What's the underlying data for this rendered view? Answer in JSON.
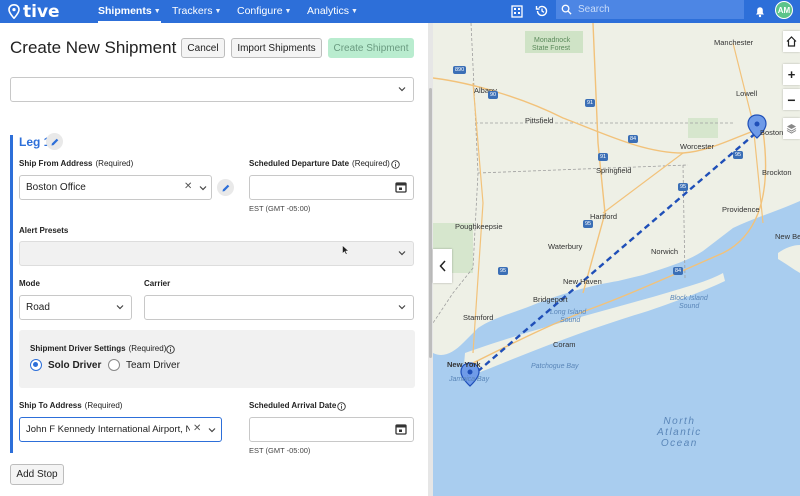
{
  "nav": {
    "brand": "tive",
    "items": [
      {
        "label": "Shipments",
        "active": true
      },
      {
        "label": "Trackers",
        "active": false
      },
      {
        "label": "Configure",
        "active": false
      },
      {
        "label": "Analytics",
        "active": false
      }
    ],
    "search_placeholder": "Search",
    "avatar_initials": "AM"
  },
  "form": {
    "title": "Create New Shipment",
    "cancel_label": "Cancel",
    "import_label": "Import Shipments",
    "create_label": "Create Shipment",
    "template_value": "",
    "leg_title": "Leg 1",
    "ship_from_label": "Ship From Address",
    "required": "(Required)",
    "ship_from_value": "Boston Office",
    "departure_label": "Scheduled Departure Date",
    "departure_value": "",
    "departure_tz": "EST (GMT -05:00)",
    "alert_presets_label": "Alert Presets",
    "mode_label": "Mode",
    "mode_value": "Road",
    "carrier_label": "Carrier",
    "carrier_value": "",
    "driver_settings_label": "Shipment Driver Settings",
    "solo_driver": "Solo Driver",
    "team_driver": "Team Driver",
    "ship_to_label": "Ship To Address",
    "ship_to_value": "John F Kennedy International Airport, Ne",
    "arrival_label": "Scheduled Arrival Date",
    "arrival_value": "",
    "arrival_tz": "EST (GMT -05:00)",
    "add_stop": "Add Stop"
  },
  "map": {
    "route_color": "#1f4fb8",
    "labels": {
      "monadnock": "Monadnock",
      "state_forest": "State Forest",
      "manchester": "Manchester",
      "lowell": "Lowell",
      "boston": "Boston",
      "albany": "Albany",
      "pittsfield": "Pittsfield",
      "worcester": "Worcester",
      "brockton": "Brockton",
      "springfield": "Springfield",
      "providence": "Providence",
      "hartford": "Hartford",
      "new_bedford": "New Be",
      "poughkeepsie": "Poughkeepsie",
      "waterbury": "Waterbury",
      "norwich": "Norwich",
      "new_haven": "New Haven",
      "bridgeport": "Bridgeport",
      "block_island_sound": "Block Island",
      "sound": "Sound",
      "long_island": "Long Island",
      "long_island_sound": "Sound",
      "stamford": "Stamford",
      "coram": "Coram",
      "new_york": "New York",
      "patchogue_bay": "Patchogue Bay",
      "jamaica_bay": "Jamaica Bay",
      "ocean_1": "North",
      "ocean_2": "Atlantic",
      "ocean_3": "Ocean"
    },
    "shields": [
      "890",
      "90",
      "91",
      "84",
      "95",
      "95",
      "84",
      "95",
      "95",
      "91"
    ]
  }
}
